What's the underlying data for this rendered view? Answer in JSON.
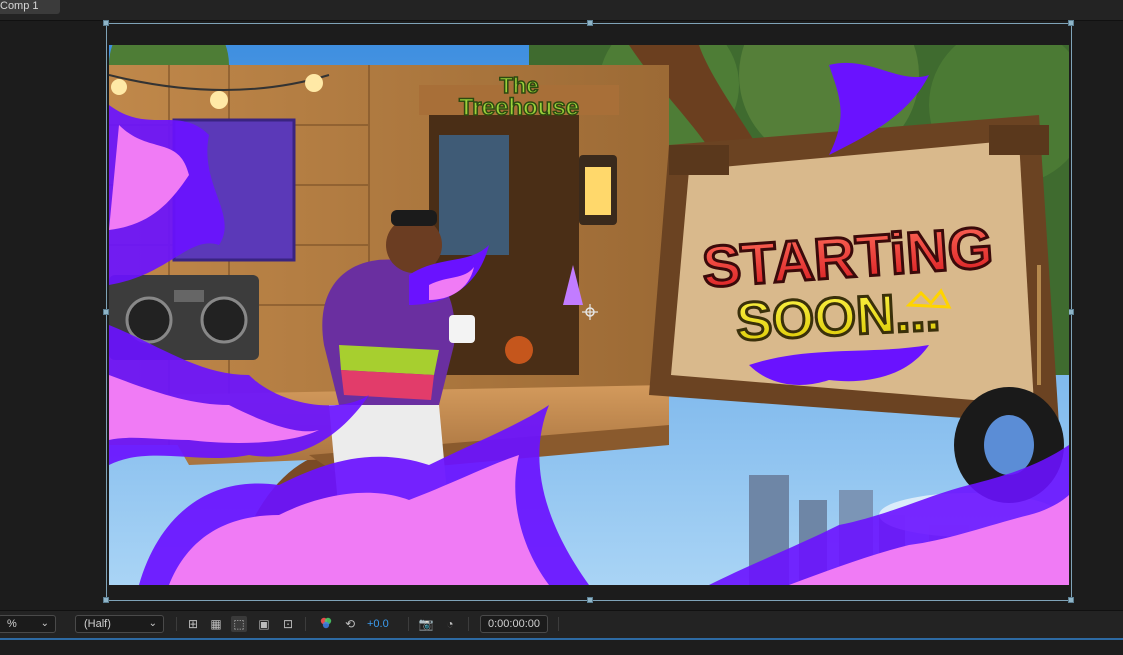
{
  "tab": {
    "label": "Comp 1"
  },
  "canvas": {
    "sign_line1": "STARTiNG",
    "sign_line2": "SOON...",
    "treehouse_line1": "The",
    "treehouse_line2": "Treehouse"
  },
  "controls": {
    "magnification": "%",
    "resolution": "(Half)",
    "exposure": "+0.0",
    "timecode": "0:00:00:00"
  },
  "colors": {
    "accent_blue": "#3b9cf0",
    "panel_bg": "#1c1c1c",
    "bounding_box": "#7fa3b8"
  }
}
